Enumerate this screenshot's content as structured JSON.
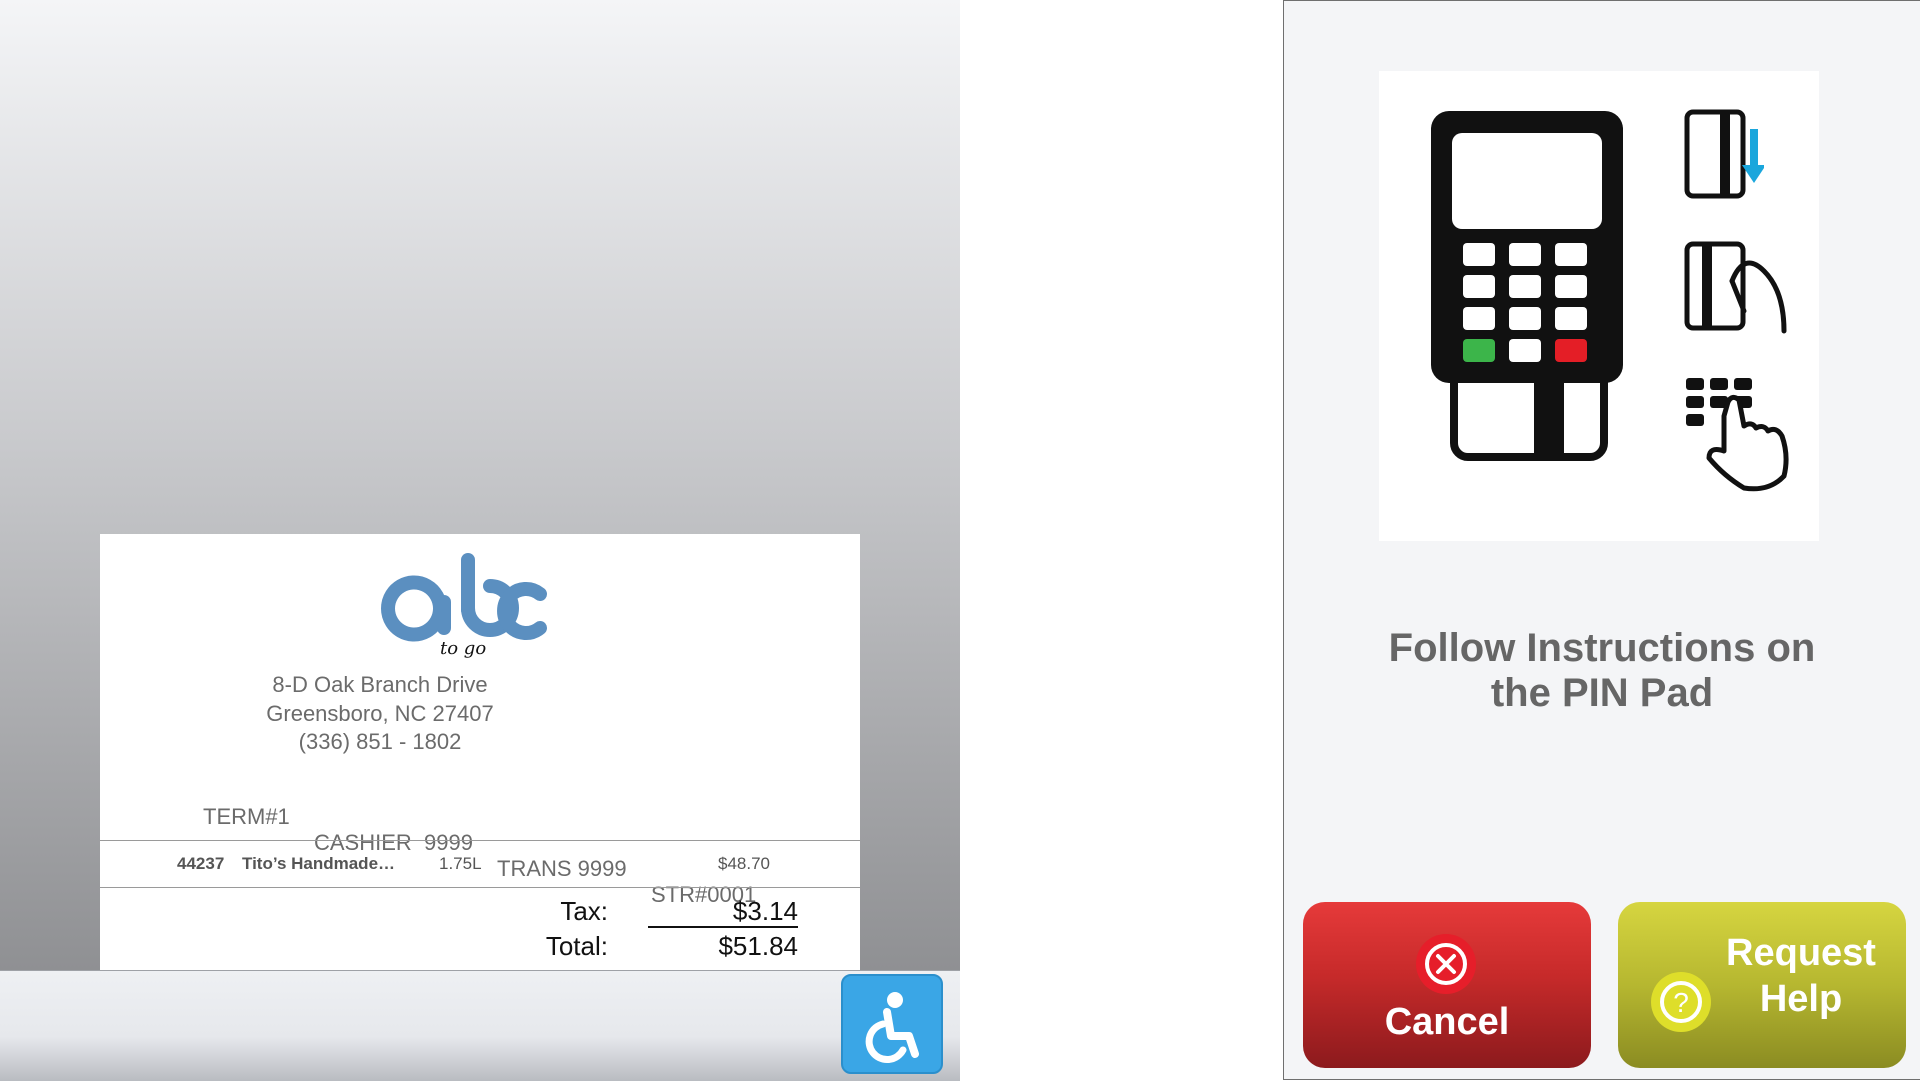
{
  "receipt": {
    "logo_text": "abc",
    "logo_subtext": "to go",
    "address_line1": "8-D  Oak Branch Drive",
    "address_line2": "Greensboro, NC 27407",
    "phone": "(336) 851 - 1802",
    "term": "TERM#1",
    "cashier": "CASHIER  9999",
    "trans": "TRANS 9999",
    "store": "STR#0001",
    "items": [
      {
        "code": "44237",
        "name": "Tito’s Handmade…",
        "size": "1.75L",
        "price": "$48.70"
      }
    ],
    "tax_label": "Tax:",
    "tax_value": "$3.14",
    "total_label": "Total:",
    "total_value": "$51.84"
  },
  "accessibility": {
    "icon": "wheelchair-icon"
  },
  "right_panel": {
    "instruction_line1": "Follow Instructions on",
    "instruction_line2": "the PIN Pad",
    "cancel_label": "Cancel",
    "help_label_line1": "Request",
    "help_label_line2": "Help"
  },
  "colors": {
    "logo_blue": "#5b8fc0",
    "cancel_red": "#c62a2a",
    "help_olive": "#b6b730",
    "access_blue": "#3aa6e6",
    "pin_green": "#3cb54a",
    "pin_red": "#e41e26",
    "arrow_blue": "#1aa6dc"
  }
}
